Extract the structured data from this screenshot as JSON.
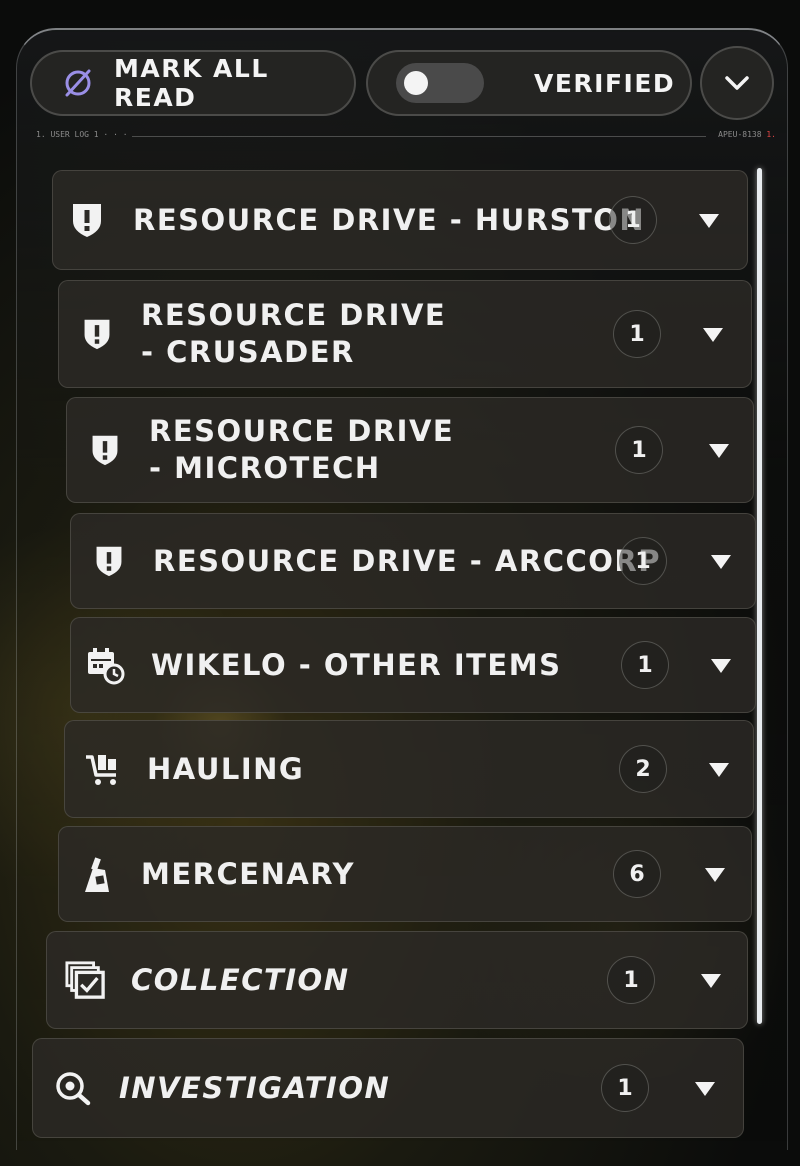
{
  "toolbar": {
    "mark_all_read_label": "MARK ALL READ",
    "verified_label": "VERIFIED",
    "verified_toggle_on": false
  },
  "log_strip": {
    "left_text": "1. USER LOG 1 · · ·",
    "right_text": "APEU-8138",
    "right_suffix": "1."
  },
  "categories": [
    {
      "label": "RESOURCE DRIVE - HURSTON",
      "count": "1",
      "icon": "shield-alert-icon"
    },
    {
      "label": "RESOURCE DRIVE - CRUSADER",
      "count": "1",
      "icon": "shield-alert-icon"
    },
    {
      "label": "RESOURCE DRIVE - MICROTECH",
      "count": "1",
      "icon": "shield-alert-icon"
    },
    {
      "label": "RESOURCE DRIVE - ARCCORP",
      "count": "1",
      "icon": "shield-alert-icon"
    },
    {
      "label": "WIKELO - OTHER ITEMS",
      "count": "1",
      "icon": "calendar-clock-icon"
    },
    {
      "label": "HAULING",
      "count": "2",
      "icon": "cart-icon"
    },
    {
      "label": "MERCENARY",
      "count": "6",
      "icon": "mercenary-icon"
    },
    {
      "label": "COLLECTION",
      "count": "1",
      "icon": "collection-check-icon"
    },
    {
      "label": "INVESTIGATION",
      "count": "1",
      "icon": "eye-magnifier-icon"
    }
  ],
  "colors": {
    "accent_icon": "#9a8fe6",
    "scrollbar": "#e8ecef",
    "row_bg": "#2c2a26"
  }
}
